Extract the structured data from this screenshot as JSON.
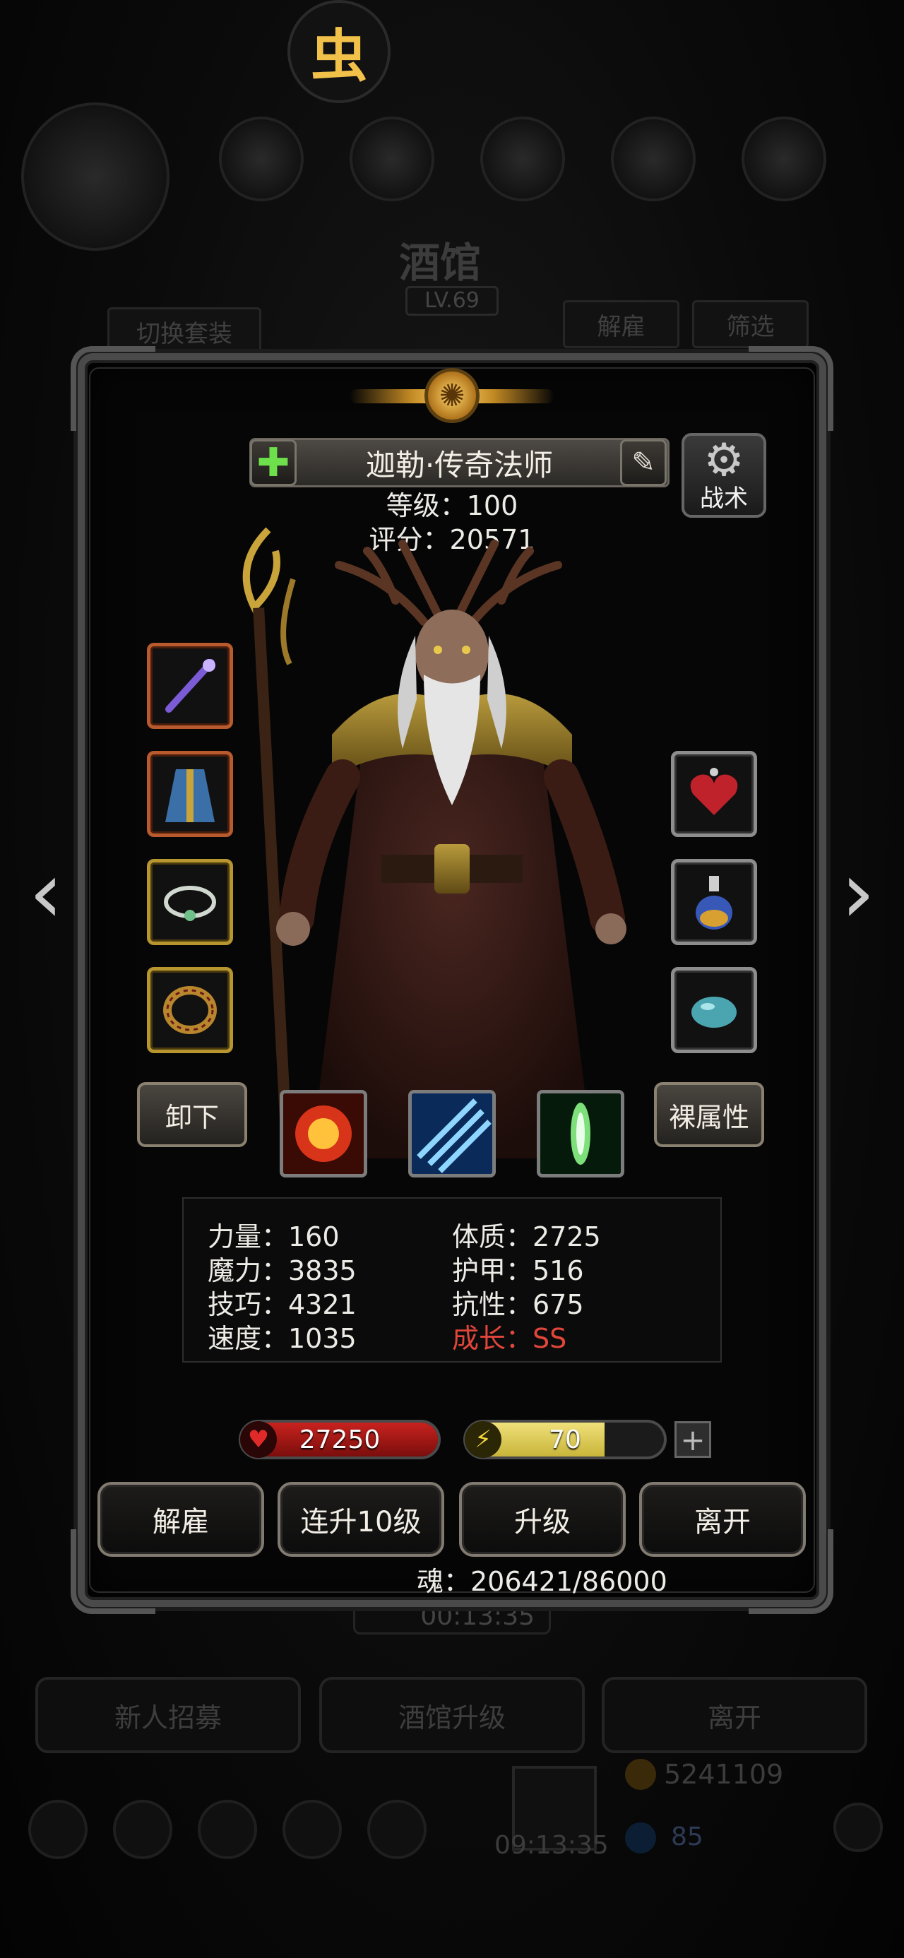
{
  "logo": {
    "glyph": "虫"
  },
  "background": {
    "title": "酒馆",
    "level": "LV.69",
    "switch_outfit": "切换套装",
    "dismiss": "解雇",
    "filter": "筛选",
    "timer": "00:13:35",
    "recruit": "新人招募",
    "upgrade_tavern": "酒馆升级",
    "leave": "离开",
    "gold": "5241109",
    "bottom_timer": "09:13:35",
    "gems": "85"
  },
  "hero": {
    "name": "迦勒·传奇法师",
    "level_text": "等级：100",
    "score_text": "评分：20571",
    "tactics_label": "战术"
  },
  "equipment": {
    "left": [
      "weapon-staff",
      "robe-armor",
      "necklace",
      "ring"
    ],
    "right": [
      "heart-amulet",
      "potion-flask",
      "blue-stone"
    ]
  },
  "actions": {
    "unequip": "卸下",
    "bare_stats": "裸属性"
  },
  "skills": [
    "fire-explosion",
    "ice-slash",
    "green-light"
  ],
  "stats": {
    "strength": "力量：160",
    "magic": "魔力：3835",
    "skill": "技巧：4321",
    "speed": "速度：1035",
    "constitution": "体质：2725",
    "armor": "护甲：516",
    "resistance": "抗性：675",
    "growth": "成长：SS"
  },
  "bars": {
    "hp": {
      "value": "27250",
      "fill": 1.0,
      "color": "#c8221e"
    },
    "energy": {
      "value": "70",
      "fill": 0.7,
      "color": "#c9b53a"
    }
  },
  "buttons": {
    "dismiss": "解雇",
    "level10": "连升10级",
    "level_up": "升级",
    "leave": "离开"
  },
  "soul": "魂：206421/86000",
  "colors": {
    "accent_gold": "#f2c14a",
    "growth_red": "#e0463a"
  }
}
